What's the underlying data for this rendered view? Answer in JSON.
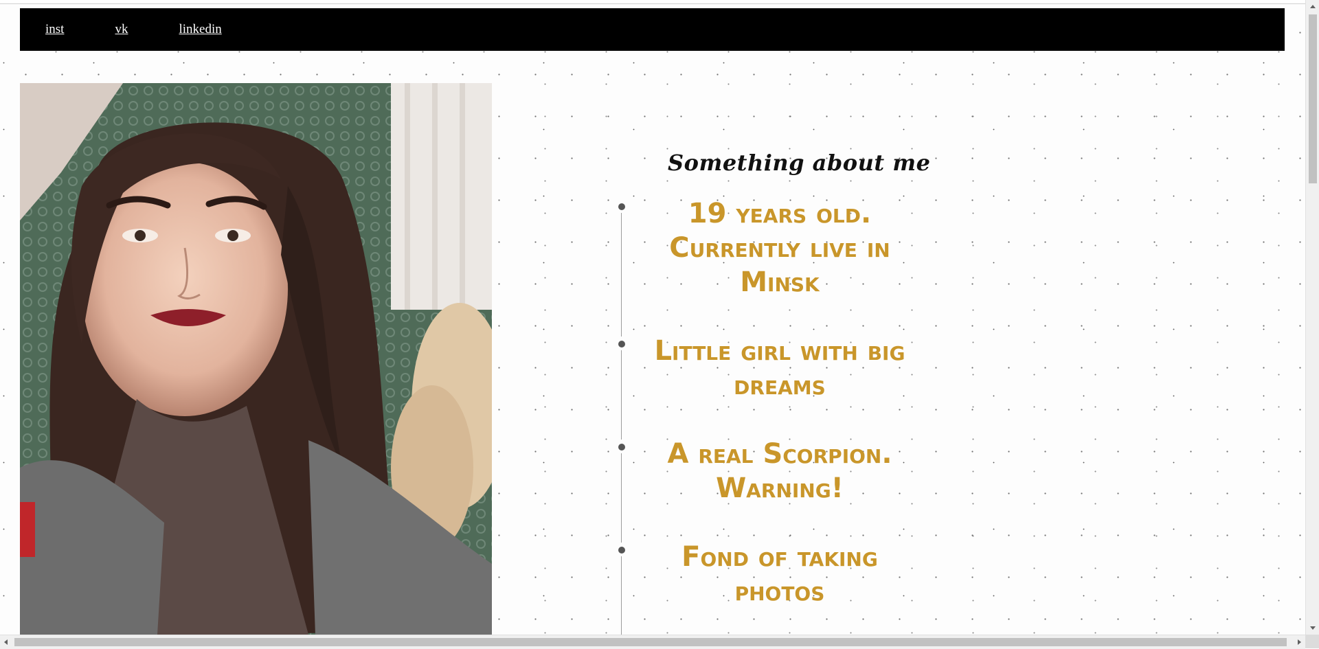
{
  "nav": {
    "links": [
      "inst",
      "vk",
      "linkedin"
    ]
  },
  "photo": {
    "alt": "Portrait photo",
    "icon": "portrait-image"
  },
  "about": {
    "title": "Something about me",
    "items": [
      "19 years old. Currently live in Minsk",
      "Little girl with big dreams",
      "A real Scorpion. Warning!",
      "Fond of taking photos"
    ]
  },
  "colors": {
    "navbar": "#000000",
    "accent": "#c9962a",
    "timeline_dot": "#555555"
  }
}
